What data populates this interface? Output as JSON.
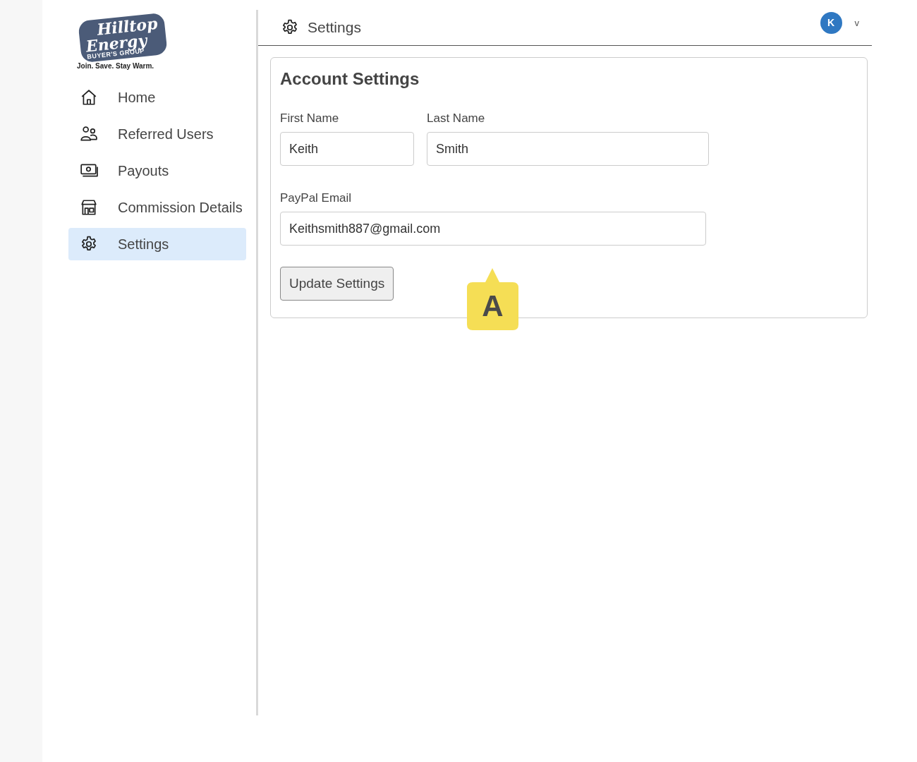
{
  "logo": {
    "line_1": "Hilltop",
    "line_2": "Energy",
    "subtitle": "BUYER'S GROUP",
    "tagline": "Join. Save. Stay Warm."
  },
  "sidebar": {
    "items": [
      {
        "kind": "home",
        "label": "Home",
        "selected": false
      },
      {
        "kind": "users",
        "label": "Referred Users",
        "selected": false
      },
      {
        "kind": "money",
        "label": "Payouts",
        "selected": false
      },
      {
        "kind": "store",
        "label": "Commission Details",
        "selected": false
      },
      {
        "kind": "gear",
        "label": "Settings",
        "selected": true
      }
    ]
  },
  "header": {
    "title": "Settings",
    "avatar": "K",
    "menu_caret": "v"
  },
  "card": {
    "title": "Account Settings",
    "fields": [
      {
        "label": "First Name",
        "value": "Keith",
        "kind": "short"
      },
      {
        "label": "Last Name",
        "value": "Smith",
        "kind": "medium"
      },
      {
        "label": "PayPal Email",
        "value": "Keithsmith887@gmail.com",
        "kind": "wide"
      }
    ],
    "button": "Update Settings"
  },
  "callout": {
    "label": "A"
  }
}
